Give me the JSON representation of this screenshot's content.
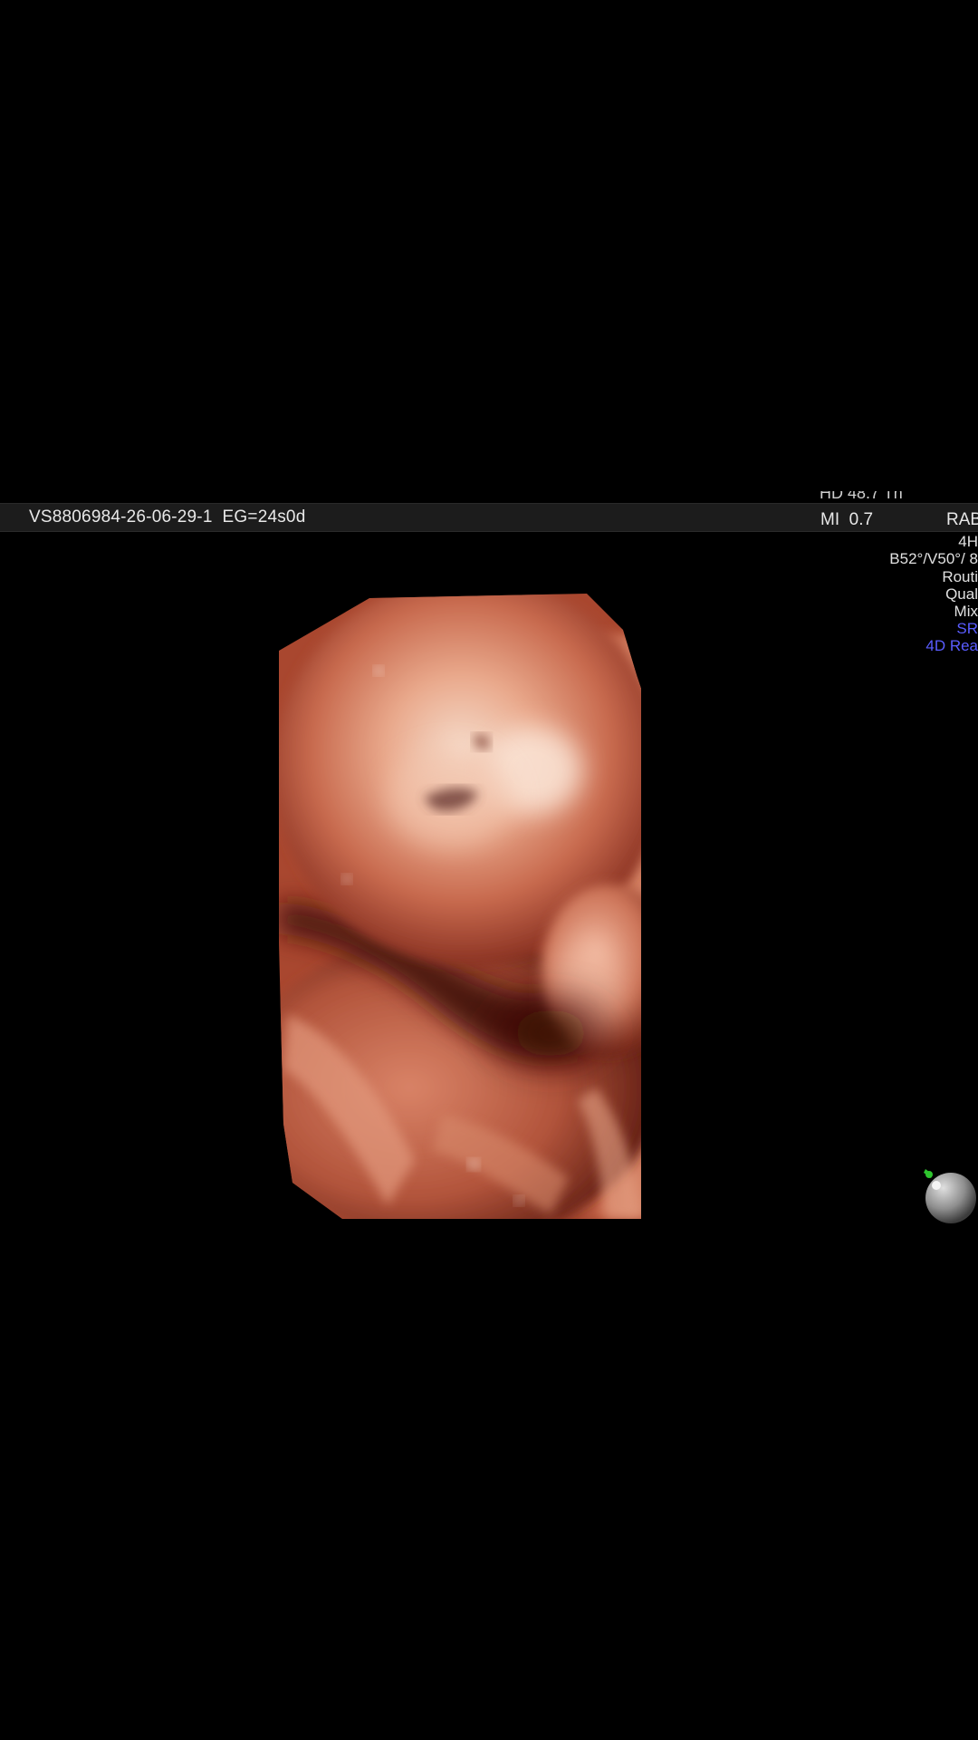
{
  "info_bar": {
    "patient_id": "VS8806984-26-06-29-1  EG=24s0d"
  },
  "params": {
    "top_partial": "HD 48.7      Th",
    "mi": "MI  0.7",
    "probe": "RAB",
    "lines": [
      {
        "text": "4H",
        "color": "white"
      },
      {
        "text": "B52°/V50°/ 8",
        "color": "white"
      },
      {
        "text": "Routi",
        "color": "white"
      },
      {
        "text": "Qual",
        "color": "white"
      },
      {
        "text": "Mix",
        "color": "white"
      },
      {
        "text": "SR",
        "color": "blue"
      },
      {
        "text": "4D Rea",
        "color": "blue"
      }
    ]
  },
  "colors": {
    "background": "#000000",
    "info_bar": "#1c1c1c",
    "skin_light": "#f0b8a0",
    "skin_mid": "#c8644a",
    "skin_dark": "#5a1a10",
    "accent_blue": "#5a5cff",
    "orientation_green": "#2ec42e"
  },
  "icons": {
    "orientation": "orientation-ball-icon"
  }
}
